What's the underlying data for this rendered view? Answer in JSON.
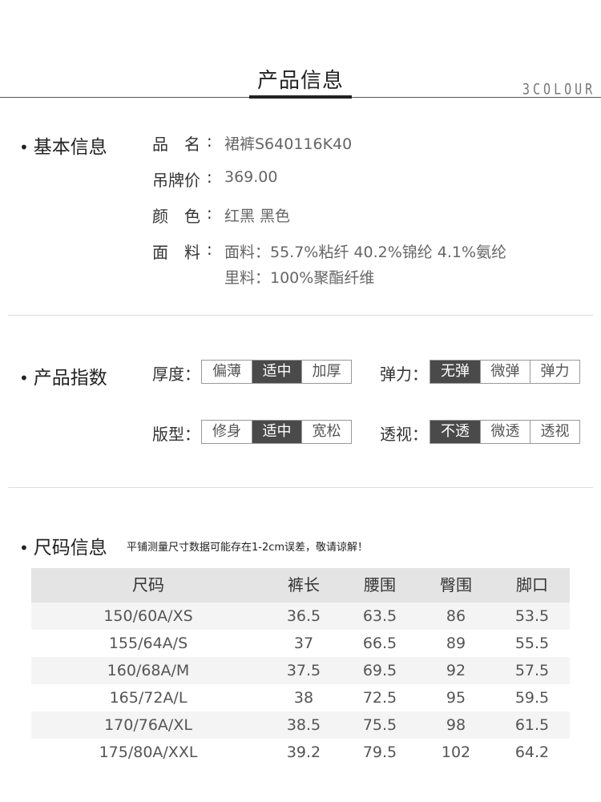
{
  "header": {
    "title": "产品信息",
    "brand": "3COLOUR"
  },
  "basic": {
    "title": "基本信息",
    "name_label": "品　名",
    "name_value": "裙裤S640116K40",
    "price_label": "吊牌价",
    "price_value": "369.00",
    "color_label": "颜　色",
    "color_value": "红黑 黑色",
    "material_label": "面　料",
    "material_line1": "面料：55.7%粘纤 40.2%锦纶 4.1%氨纶",
    "material_line2": "里料：100%聚酯纤维"
  },
  "index": {
    "title": "产品指数",
    "thickness": {
      "label": "厚度",
      "options": [
        "偏薄",
        "适中",
        "加厚"
      ],
      "selected": 1
    },
    "elasticity": {
      "label": "弹力",
      "options": [
        "无弹",
        "微弹",
        "弹力"
      ],
      "selected": 0
    },
    "fit": {
      "label": "版型",
      "options": [
        "修身",
        "适中",
        "宽松"
      ],
      "selected": 1
    },
    "sheer": {
      "label": "透视",
      "options": [
        "不透",
        "微透",
        "透视"
      ],
      "selected": 0
    },
    "colors": {
      "selected_bg": "#4a4a4a",
      "border": "#999999"
    }
  },
  "size": {
    "title": "尺码信息",
    "note": "平铺测量尺寸数据可能存在1-2cm误差，敬请谅解！",
    "headers": [
      "尺码",
      "裤长",
      "腰围",
      "臀围",
      "脚口"
    ],
    "rows": [
      [
        "150/60A/XS",
        "36.5",
        "63.5",
        "86",
        "53.5"
      ],
      [
        "155/64A/S",
        "37",
        "66.5",
        "89",
        "55.5"
      ],
      [
        "160/68A/M",
        "37.5",
        "69.5",
        "92",
        "57.5"
      ],
      [
        "165/72A/L",
        "38",
        "72.5",
        "95",
        "59.5"
      ],
      [
        "170/76A/XL",
        "38.5",
        "75.5",
        "98",
        "61.5"
      ],
      [
        "175/80A/XXL",
        "39.2",
        "79.5",
        "102",
        "64.2"
      ]
    ]
  }
}
